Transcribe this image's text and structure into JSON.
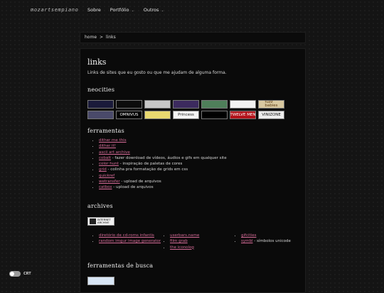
{
  "header": {
    "brand": "mozartsempiano",
    "nav": [
      {
        "label": "Sobre",
        "dropdown": false
      },
      {
        "label": "Portfólio",
        "dropdown": true
      },
      {
        "label": "Outros",
        "dropdown": true
      }
    ],
    "chevron": "⌄"
  },
  "breadcrumb": {
    "home": "home",
    "separator": ">",
    "current": "links"
  },
  "main": {
    "title": "links",
    "intro": "Links de sites que eu gosto ou que me ajudam de alguma forma."
  },
  "neocities": {
    "heading": "neocities",
    "buttons": [
      {
        "label": "",
        "bg": "#1a1a3a",
        "fg": "#8da0ff"
      },
      {
        "label": "",
        "bg": "#0c0c0c",
        "fg": "#b06bd6"
      },
      {
        "label": "",
        "bg": "#c8c8c8",
        "fg": "#222222"
      },
      {
        "label": "",
        "bg": "#3c2a5e",
        "fg": "#d7c2ff"
      },
      {
        "label": "",
        "bg": "#4f7f5a",
        "fg": "#e9f5d6"
      },
      {
        "label": "",
        "bg": "#f2f2f2",
        "fg": "#222222"
      },
      {
        "label": "fuzz\nbabies",
        "bg": "#d8c8a0",
        "fg": "#5a3a10"
      },
      {
        "label": "",
        "bg": "#4a4a6a",
        "fg": "#ffffff"
      },
      {
        "label": "OMNIVUS",
        "bg": "#000000",
        "fg": "#ffffff"
      },
      {
        "label": "",
        "bg": "#e8d870",
        "fg": "#4a3a00"
      },
      {
        "label": "Princess",
        "bg": "#f4f4f4",
        "fg": "#222222"
      },
      {
        "label": "",
        "bg": "#000000",
        "fg": "#e0e0e0"
      },
      {
        "label": "TWELVE MEN",
        "bg": "#b3131b",
        "fg": "#ffffff"
      },
      {
        "label": "VINIZONE",
        "bg": "#ececec",
        "fg": "#111111"
      }
    ]
  },
  "ferramentas": {
    "heading": "ferramentas",
    "items": [
      {
        "link": "dither me this",
        "desc": ""
      },
      {
        "link": "dither it!",
        "desc": ""
      },
      {
        "link": "ascii art archive",
        "desc": ""
      },
      {
        "link": "cobalt",
        "desc": " - fazer download de vídeos, áudios e gifs em qualquer site"
      },
      {
        "link": "color hunt",
        "desc": " - inspiração de paletas de cores"
      },
      {
        "link": "grid",
        "desc": " - colinha pra formatação de grids em css"
      },
      {
        "link": "quickref",
        "desc": ""
      },
      {
        "link": "wetransfer",
        "desc": " - upload de arquivos"
      },
      {
        "link": "catbox",
        "desc": " - upload de arquivos"
      }
    ]
  },
  "archives": {
    "heading": "archives",
    "logo_line1": "INTERNET",
    "logo_line2": "ARCHIVE",
    "col1": [
      {
        "link": "diretório de cd-roms infantis",
        "desc": ""
      },
      {
        "link": "random imgur image generator",
        "desc": ""
      }
    ],
    "col2": [
      {
        "link": "userbars.name",
        "desc": ""
      },
      {
        "link": "film grab",
        "desc": ""
      },
      {
        "link": "the iconolog",
        "desc": ""
      }
    ],
    "col3": [
      {
        "link": "gifcities",
        "desc": ""
      },
      {
        "link": "symbl",
        "desc": " - símbolos unicode"
      }
    ]
  },
  "busca": {
    "heading": "ferramentas de busca",
    "button_label": ""
  },
  "crt": {
    "label": "CRT",
    "on": false
  }
}
